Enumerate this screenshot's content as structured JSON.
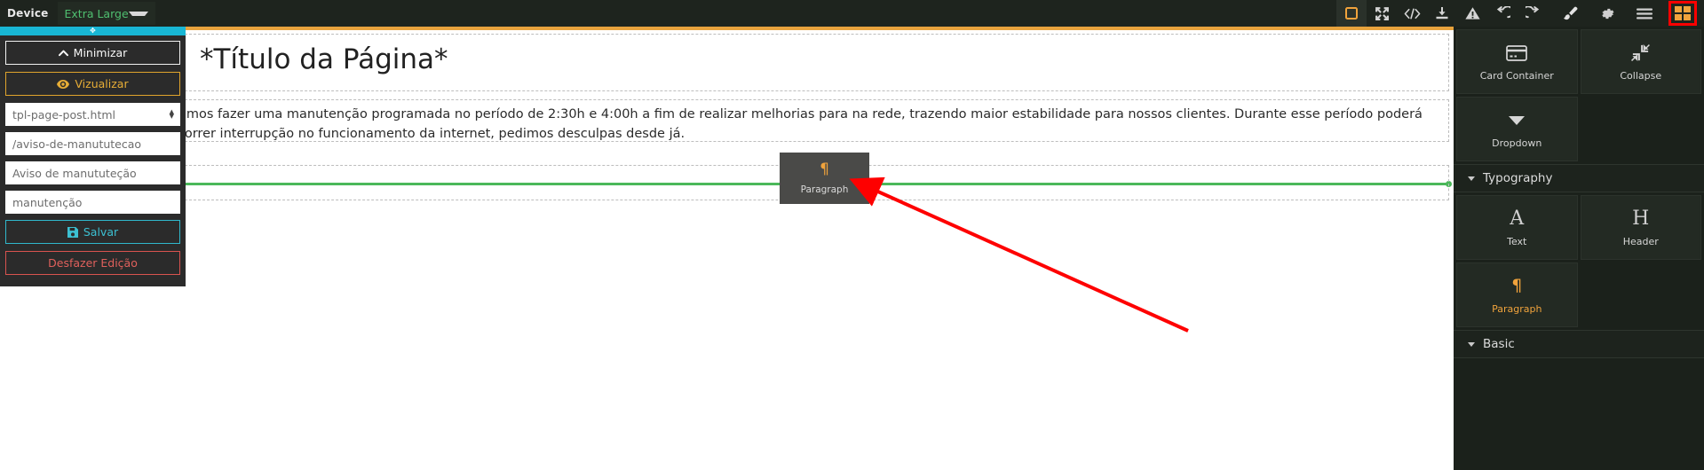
{
  "toolbar": {
    "device_label": "Device",
    "device_value": "Extra Large",
    "icons": [
      {
        "name": "square-outline-icon",
        "title": "Borders"
      },
      {
        "name": "expand-arrows-icon",
        "title": "Fullscreen"
      },
      {
        "name": "code-icon",
        "title": "Source code"
      },
      {
        "name": "download-icon",
        "title": "Download"
      },
      {
        "name": "warning-triangle-icon",
        "title": "Warnings"
      },
      {
        "name": "undo-icon",
        "title": "Undo"
      },
      {
        "name": "redo-icon",
        "title": "Redo"
      },
      {
        "name": "paintbrush-icon",
        "title": "Style"
      },
      {
        "name": "gear-icon",
        "title": "Settings"
      },
      {
        "name": "hamburger-menu-icon",
        "title": "Menu"
      },
      {
        "name": "grid-blocks-icon",
        "title": "Components"
      }
    ],
    "accent_orange": "#f0a33c",
    "highlight_red": "#fe0000"
  },
  "panel": {
    "minimizar_label": "Minimizar",
    "vizualizar_label": "Vizualizar",
    "template_value": "tpl-page-post.html",
    "slug_value": "/aviso-de-manututecao",
    "title_value": "Aviso de manututeção",
    "tags_value": "manutenção",
    "salvar_label": "Salvar",
    "desfazer_label": "Desfazer Edição",
    "handle_glyph": "✥",
    "colors": {
      "handle": "#18b6d4",
      "vizualizar": "#e7ad36",
      "salvar": "#3cc0d2",
      "desfazer": "#e0605c"
    }
  },
  "canvas": {
    "page_title": "*Título da Página*",
    "paragraph": "Iremos fazer uma manutenção programada no período de 2:30h e 4:00h a fim de realizar melhorias para na rede, trazendo maior estabilidade para nossos clientes. Durante esse período poderá ocorrer interrupção no funcionamento da internet, pedimos desculpas desde já.",
    "drag_ghost": {
      "label": "Paragraph",
      "glyph": "¶"
    },
    "drop_indicator_color": "#4bb85a",
    "annotation_arrow_color": "#fe0000"
  },
  "sidebar": {
    "components": [
      {
        "label": "Card Container",
        "icon": "credit-card-icon",
        "active": false
      },
      {
        "label": "Collapse",
        "icon": "compress-arrows-icon",
        "active": false
      },
      {
        "label": "Dropdown",
        "icon": "caret-down-icon",
        "active": false
      }
    ],
    "sections": [
      {
        "label": "Typography",
        "expanded": true
      },
      {
        "label": "Basic",
        "expanded": true
      }
    ],
    "typography_components": [
      {
        "label": "Text",
        "icon": "letter-a-icon",
        "active": false
      },
      {
        "label": "Header",
        "icon": "letter-h-icon",
        "active": false
      },
      {
        "label": "Paragraph",
        "icon": "pilcrow-icon",
        "active": true
      }
    ]
  }
}
